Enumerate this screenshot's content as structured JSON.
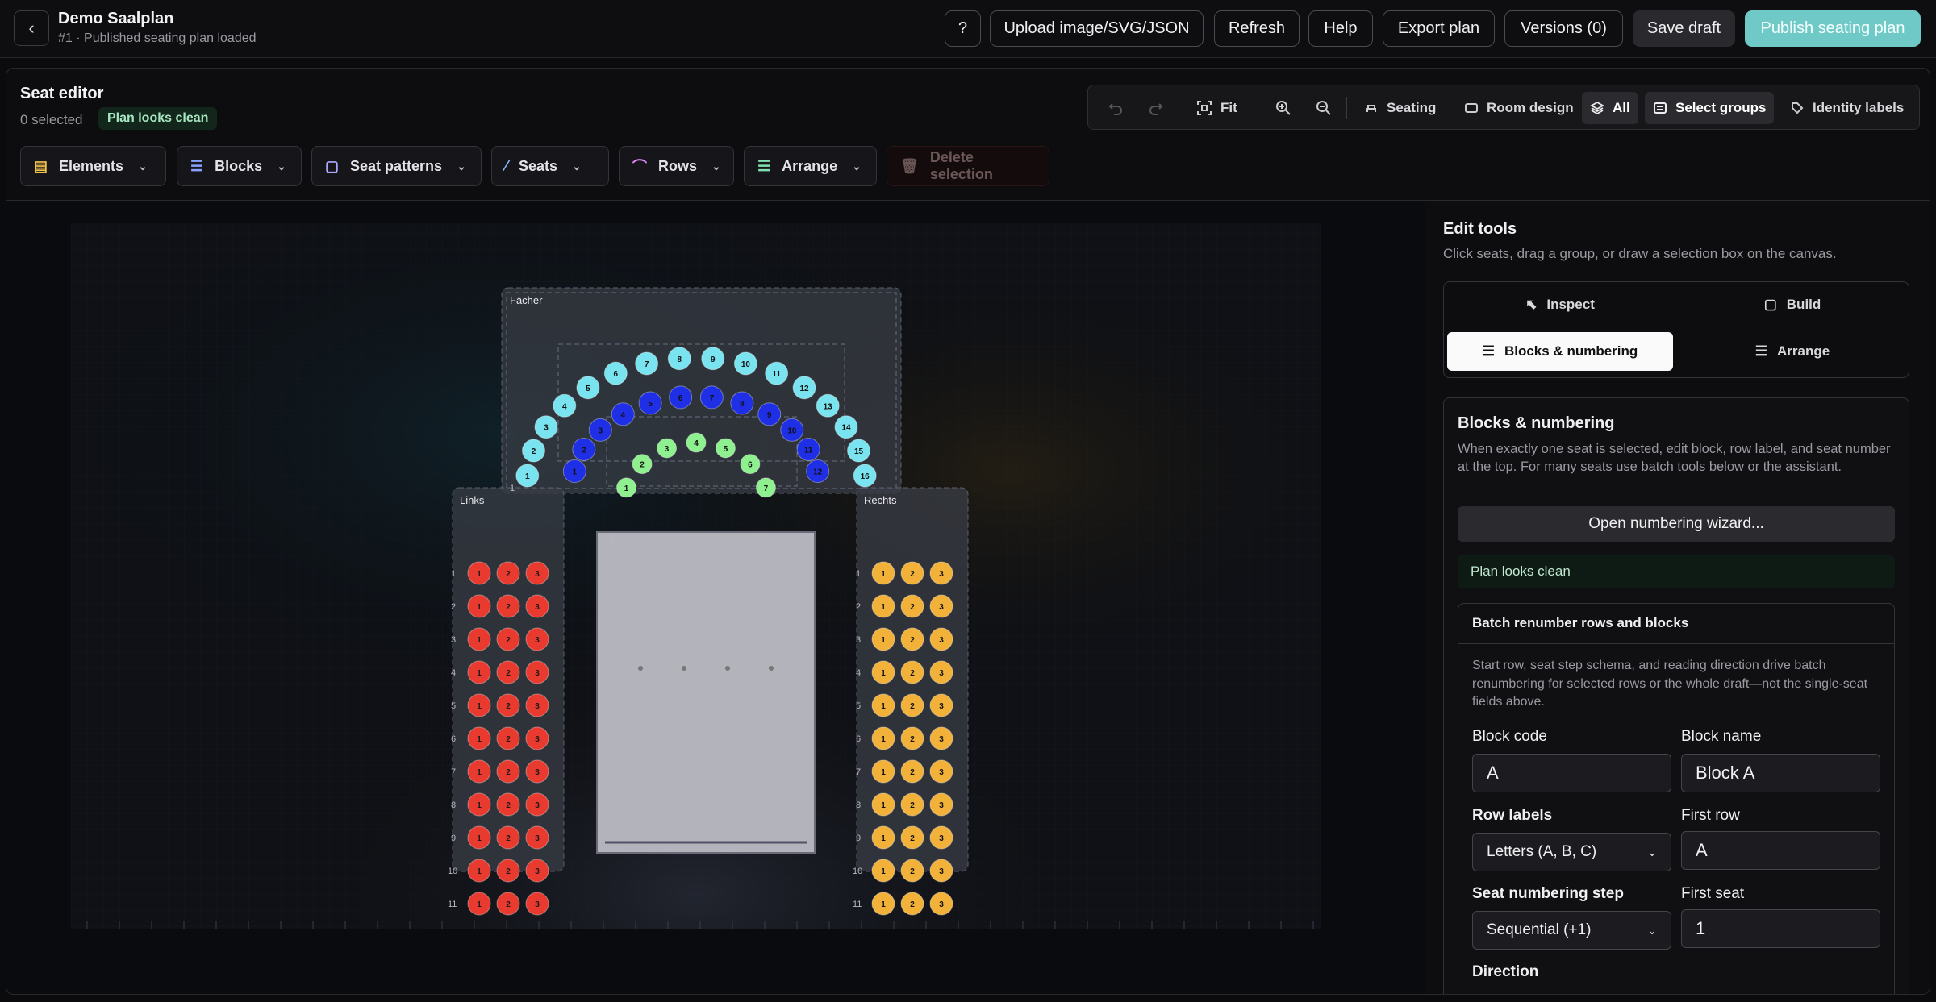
{
  "header": {
    "title": "Demo Saalplan",
    "subtitle": "#1 · Published seating plan loaded",
    "help_q": "?",
    "upload": "Upload image/SVG/JSON",
    "refresh": "Refresh",
    "help": "Help",
    "export": "Export plan",
    "versions": "Versions (0)",
    "save": "Save draft",
    "publish": "Publish seating plan"
  },
  "editor": {
    "title": "Seat editor",
    "selected": "0 selected",
    "status": "Plan looks clean"
  },
  "toolbar": {
    "fit": "Fit",
    "seating": "Seating",
    "room": "Room design",
    "all": "All",
    "select_groups": "Select groups",
    "identity": "Identity labels"
  },
  "dropdowns": {
    "elements": "Elements",
    "blocks": "Blocks",
    "patterns": "Seat patterns",
    "seats": "Seats",
    "rows": "Rows",
    "arrange": "Arrange",
    "delete": "Delete selection"
  },
  "canvas": {
    "block_faecher": "Fächer",
    "block_links": "Links",
    "block_rechts": "Rechts",
    "faecher_rows": [
      {
        "label": "1",
        "seats": [
          "1",
          "2",
          "3",
          "4",
          "5",
          "6",
          "7",
          "8",
          "9",
          "10",
          "11",
          "12",
          "13",
          "14",
          "15",
          "16"
        ],
        "color": "#79e4f0"
      },
      {
        "label": "",
        "seats": [
          "1",
          "2",
          "3",
          "4",
          "5",
          "6",
          "7",
          "8",
          "9",
          "10",
          "11",
          "12"
        ],
        "color": "#1f2fe6"
      },
      {
        "label": "",
        "seats": [
          "1",
          "2",
          "3",
          "4",
          "5",
          "6",
          "7"
        ],
        "color": "#8ef08e"
      }
    ],
    "row5_label": "5",
    "links_rows": [
      "1",
      "2",
      "3",
      "4",
      "5",
      "6",
      "7",
      "8",
      "9",
      "10",
      "11"
    ],
    "links_seats": [
      "1",
      "2",
      "3"
    ],
    "links_color": "#e83a2e",
    "rechts_seats": [
      "1",
      "2",
      "3"
    ],
    "rechts_color": "#f2b138"
  },
  "sidebar": {
    "title": "Edit tools",
    "desc": "Click seats, drag a group, or draw a selection box on the canvas.",
    "tabs": {
      "inspect": "Inspect",
      "build": "Build",
      "blocks": "Blocks & numbering",
      "arrange": "Arrange"
    },
    "card": {
      "title": "Blocks & numbering",
      "desc": "When exactly one seat is selected, edit block, row label, and seat number at the top. For many seats use batch tools below or the assistant.",
      "wizard": "Open numbering wizard...",
      "clean": "Plan looks clean",
      "batch": {
        "title": "Batch renumber rows and blocks",
        "desc": "Start row, seat step schema, and reading direction drive batch renumbering for selected rows or the whole draft—not the single-seat fields above.",
        "block_code_label": "Block code",
        "block_code": "A",
        "block_name_label": "Block name",
        "block_name": "Block A",
        "row_labels_label": "Row labels",
        "row_labels": "Letters (A, B, C)",
        "first_row_label": "First row",
        "first_row": "A",
        "step_label": "Seat numbering step",
        "step": "Sequential (+1)",
        "first_seat_label": "First seat",
        "first_seat": "1",
        "direction_label": "Direction"
      }
    }
  }
}
